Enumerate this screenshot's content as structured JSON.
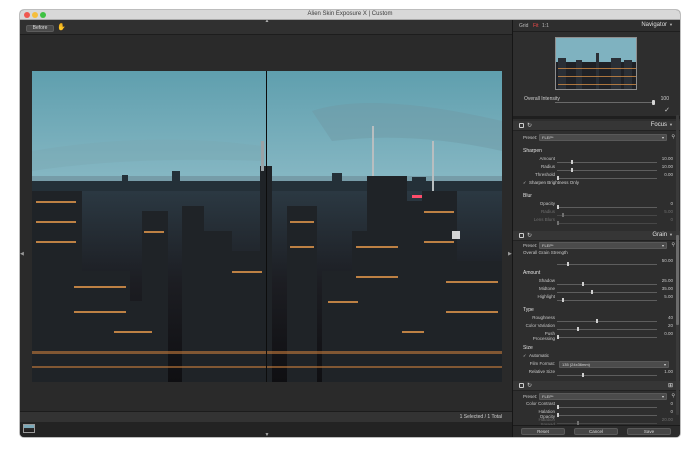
{
  "window": {
    "title": "Alien Skin Exposure X | Custom"
  },
  "viewer": {
    "before_label": "Before",
    "hand_glyph": "✋",
    "status": "1 Selected / 1 Total"
  },
  "navigator": {
    "tabs": [
      "Grid",
      "Fit",
      "1:1"
    ],
    "title": "Navigator",
    "intensity_label": "Overall Intensity",
    "intensity_value": "100",
    "intensity_level": 1.0
  },
  "focus": {
    "title": "Focus",
    "preset_label": "Preset:",
    "preset_value": "FLEP*",
    "sharpen_title": "Sharpen",
    "sharpen": [
      {
        "label": "Amount",
        "value": "10.00",
        "level": 0.14
      },
      {
        "label": "Radius",
        "value": "10.00",
        "level": 0.14
      },
      {
        "label": "Threshold",
        "value": "0.00",
        "level": 0.0
      }
    ],
    "sharpen_brightness": "Sharpen Brightness Only",
    "blur_title": "Blur",
    "blur": [
      {
        "label": "Opacity",
        "value": "0",
        "level": 0.0,
        "dim": false
      },
      {
        "label": "Radius",
        "value": "5.00",
        "level": 0.05,
        "dim": true
      },
      {
        "label": "Lens Blurs",
        "value": "0",
        "level": 0.0,
        "dim": true
      }
    ]
  },
  "grain": {
    "title": "Grain",
    "preset_label": "Preset:",
    "preset_value": "FLEP*",
    "overall_label": "Overall Grain Strength",
    "overall_value": "50.00",
    "overall_level": 0.1,
    "amount_title": "Amount",
    "amount": [
      {
        "label": "Shadow",
        "value": "25.00",
        "level": 0.25
      },
      {
        "label": "Midtone",
        "value": "35.00",
        "level": 0.35
      },
      {
        "label": "Highlight",
        "value": "5.00",
        "level": 0.05
      }
    ],
    "type_title": "Type",
    "type": [
      {
        "label": "Roughness",
        "value": "40",
        "level": 0.4
      },
      {
        "label": "Color Variation",
        "value": "20",
        "level": 0.2
      },
      {
        "label": "Push Processing",
        "value": "0.00",
        "level": 0.0
      }
    ],
    "size_title": "Size",
    "automatic": "Automatic",
    "film_format_label": "Film Format:",
    "film_format_value": "135 (24x36mm)",
    "relative_size_label": "Relative Size",
    "relative_size_value": "1.00",
    "relative_size_level": 0.25
  },
  "section3": {
    "preset_label": "Preset:",
    "preset_value": "FLEP*",
    "rows": [
      {
        "label": "Color Contrast",
        "value": "0",
        "level": 0.0,
        "dim": false
      },
      {
        "label": "Halation Opacity",
        "value": "0",
        "level": 0.0,
        "dim": false
      },
      {
        "label": "Halation Spread",
        "value": "20.00",
        "level": 0.2,
        "dim": true
      }
    ]
  },
  "footer": {
    "reset": "Reset",
    "cancel": "Cancel",
    "save": "Save"
  }
}
